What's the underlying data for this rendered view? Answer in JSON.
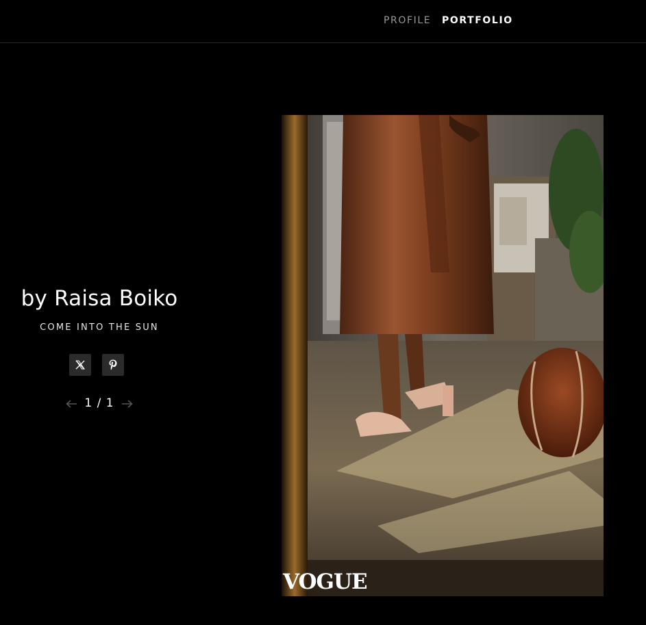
{
  "nav": {
    "profile": "PROFILE",
    "portfolio": "PORTFOLIO"
  },
  "gallery": {
    "artist": "by Raisa Boiko",
    "title": "COME INTO THE SUN",
    "counter": "1 / 1"
  },
  "share": {
    "x_icon": "x-icon",
    "pinterest_icon": "pinterest-icon"
  },
  "photo": {
    "watermark": "VOGUE"
  },
  "colors": {
    "background": "#000000",
    "nav_inactive": "#9a9a9a",
    "button_bg": "#2b2b2b"
  }
}
